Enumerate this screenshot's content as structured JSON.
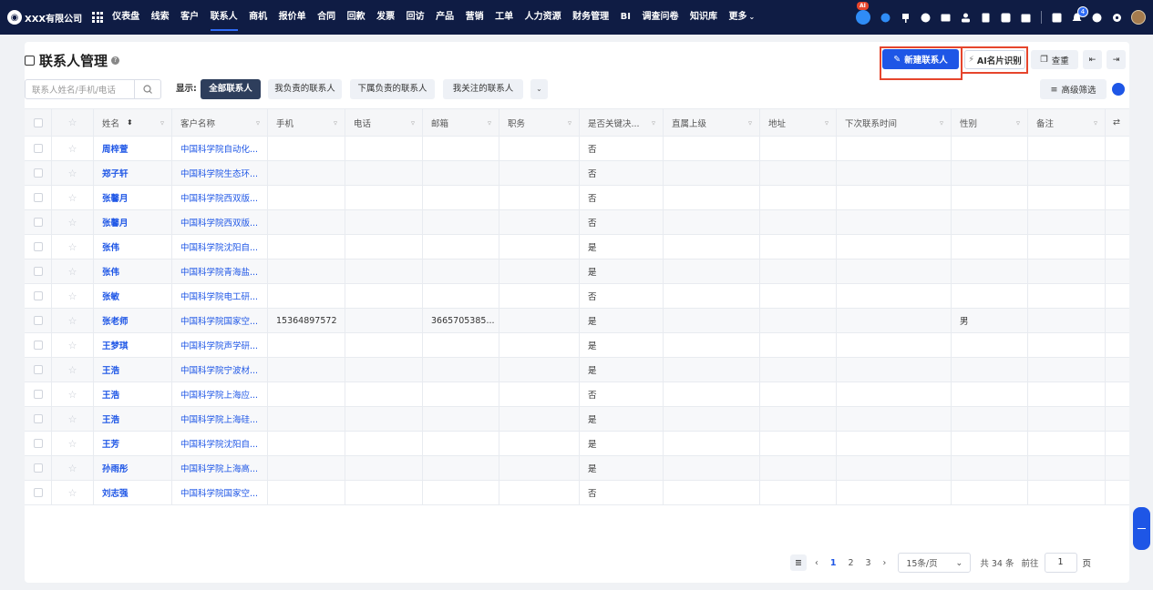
{
  "brand": {
    "company": "XXX有限公司"
  },
  "nav": {
    "items": [
      "仪表盘",
      "线索",
      "客户",
      "联系人",
      "商机",
      "报价单",
      "合同",
      "回款",
      "发票",
      "回访",
      "产品",
      "营销",
      "工单",
      "人力资源",
      "财务管理",
      "BI",
      "调查问卷",
      "知识库",
      "更多"
    ],
    "active": "联系人",
    "ai_badge": "AI",
    "notify_count": "4"
  },
  "page": {
    "title": "联系人管理"
  },
  "toolbar": {
    "new_contact": "新建联系人",
    "ai_card": "AI名片识别",
    "dedupe": "查重"
  },
  "search": {
    "placeholder": "联系人姓名/手机/电话"
  },
  "filter": {
    "show_label": "显示:",
    "tabs": [
      "全部联系人",
      "我负责的联系人",
      "下属负责的联系人",
      "我关注的联系人"
    ],
    "active_tab": "全部联系人",
    "advanced": "高级筛选"
  },
  "table": {
    "columns": [
      "姓名",
      "客户名称",
      "手机",
      "电话",
      "邮箱",
      "职务",
      "是否关键决...",
      "直属上级",
      "地址",
      "下次联系时间",
      "性别",
      "备注"
    ],
    "rows": [
      {
        "name": "周梓萱",
        "customer": "中国科学院自动化...",
        "mobile": "",
        "phone": "",
        "email": "",
        "title": "",
        "key": "否",
        "superior": "",
        "address": "",
        "next": "",
        "gender": "",
        "remark": ""
      },
      {
        "name": "郑子轩",
        "customer": "中国科学院生态环...",
        "mobile": "",
        "phone": "",
        "email": "",
        "title": "",
        "key": "否",
        "superior": "",
        "address": "",
        "next": "",
        "gender": "",
        "remark": ""
      },
      {
        "name": "张馨月",
        "customer": "中国科学院西双版...",
        "mobile": "",
        "phone": "",
        "email": "",
        "title": "",
        "key": "否",
        "superior": "",
        "address": "",
        "next": "",
        "gender": "",
        "remark": ""
      },
      {
        "name": "张馨月",
        "customer": "中国科学院西双版...",
        "mobile": "",
        "phone": "",
        "email": "",
        "title": "",
        "key": "否",
        "superior": "",
        "address": "",
        "next": "",
        "gender": "",
        "remark": ""
      },
      {
        "name": "张伟",
        "customer": "中国科学院沈阳自...",
        "mobile": "",
        "phone": "",
        "email": "",
        "title": "",
        "key": "是",
        "superior": "",
        "address": "",
        "next": "",
        "gender": "",
        "remark": ""
      },
      {
        "name": "张伟",
        "customer": "中国科学院青海盐...",
        "mobile": "",
        "phone": "",
        "email": "",
        "title": "",
        "key": "是",
        "superior": "",
        "address": "",
        "next": "",
        "gender": "",
        "remark": ""
      },
      {
        "name": "张敏",
        "customer": "中国科学院电工研...",
        "mobile": "",
        "phone": "",
        "email": "",
        "title": "",
        "key": "否",
        "superior": "",
        "address": "",
        "next": "",
        "gender": "",
        "remark": ""
      },
      {
        "name": "张老师",
        "customer": "中国科学院国家空...",
        "mobile": "15364897572",
        "phone": "",
        "email": "3665705385...",
        "title": "",
        "key": "是",
        "superior": "",
        "address": "",
        "next": "",
        "gender": "男",
        "remark": ""
      },
      {
        "name": "王梦琪",
        "customer": "中国科学院声学研...",
        "mobile": "",
        "phone": "",
        "email": "",
        "title": "",
        "key": "是",
        "superior": "",
        "address": "",
        "next": "",
        "gender": "",
        "remark": ""
      },
      {
        "name": "王浩",
        "customer": "中国科学院宁波材...",
        "mobile": "",
        "phone": "",
        "email": "",
        "title": "",
        "key": "是",
        "superior": "",
        "address": "",
        "next": "",
        "gender": "",
        "remark": ""
      },
      {
        "name": "王浩",
        "customer": "中国科学院上海应...",
        "mobile": "",
        "phone": "",
        "email": "",
        "title": "",
        "key": "否",
        "superior": "",
        "address": "",
        "next": "",
        "gender": "",
        "remark": ""
      },
      {
        "name": "王浩",
        "customer": "中国科学院上海硅...",
        "mobile": "",
        "phone": "",
        "email": "",
        "title": "",
        "key": "是",
        "superior": "",
        "address": "",
        "next": "",
        "gender": "",
        "remark": ""
      },
      {
        "name": "王芳",
        "customer": "中国科学院沈阳自...",
        "mobile": "",
        "phone": "",
        "email": "",
        "title": "",
        "key": "是",
        "superior": "",
        "address": "",
        "next": "",
        "gender": "",
        "remark": ""
      },
      {
        "name": "孙雨彤",
        "customer": "中国科学院上海高...",
        "mobile": "",
        "phone": "",
        "email": "",
        "title": "",
        "key": "是",
        "superior": "",
        "address": "",
        "next": "",
        "gender": "",
        "remark": ""
      },
      {
        "name": "刘志强",
        "customer": "中国科学院国家空...",
        "mobile": "",
        "phone": "",
        "email": "",
        "title": "",
        "key": "否",
        "superior": "",
        "address": "",
        "next": "",
        "gender": "",
        "remark": ""
      }
    ]
  },
  "pagination": {
    "pages": [
      "1",
      "2",
      "3"
    ],
    "current": "1",
    "page_size": "15条/页",
    "total": "共 34 条",
    "goto_label": "前往",
    "goto_value": "1",
    "page_unit": "页"
  },
  "colors": {
    "nav_bg": "#0f1c44",
    "primary": "#1e56e6",
    "highlight": "#e6452c"
  }
}
